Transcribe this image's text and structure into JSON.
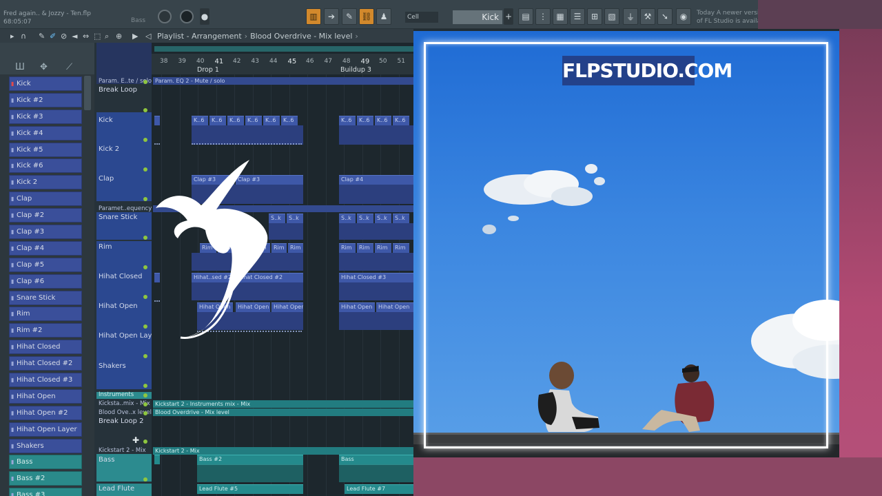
{
  "topbar": {
    "song_title": "Fred again.. & Jozzy - Ten.flp",
    "time": "68:05:07",
    "channel_label": "Bass",
    "snap_label": "Cell",
    "selected_channel": "Kick",
    "update_line1": "Today  A newer version",
    "update_line2": "of FL Studio is available!"
  },
  "playlist": {
    "breadcrumb": [
      "Playlist - Arrangement",
      "Blood Overdrive - Mix level"
    ],
    "ruler_numbers": [
      "38",
      "39",
      "40",
      "41",
      "42",
      "43",
      "44",
      "45",
      "46",
      "47",
      "48",
      "49",
      "50",
      "51"
    ],
    "markers": [
      "Drop 1",
      "Buildup 3"
    ]
  },
  "channel_rack": {
    "tracks": [
      "Kick",
      "Kick #2",
      "Kick #3",
      "Kick #4",
      "Kick #5",
      "Kick #6",
      "Kick 2",
      "Clap",
      "Clap #2",
      "Clap #3",
      "Clap #4",
      "Clap #5",
      "Clap #6",
      "Snare Stick",
      "Rim",
      "Rim #2",
      "Hihat Closed",
      "Hihat Closed #2",
      "Hihat Closed #3",
      "Hihat Open",
      "Hihat Open #2",
      "Hihat Open Layer",
      "Shakers",
      "Bass",
      "Bass #2",
      "Bass #3"
    ]
  },
  "playlist_tracks": {
    "top_auto": "Param. E..te / solo",
    "rows": [
      "Break Loop",
      "Kick",
      "Kick 2",
      "Clap",
      "Snare Stick",
      "Rim",
      "Hihat Closed",
      "Hihat Open",
      "Hihat Open Layer",
      "Shakers"
    ],
    "param_freq": "Paramet..equency",
    "instruments": "Instruments",
    "kickstart_mix": "Kicksta..mix - Mix",
    "blood_level": "Blood Ove..x level",
    "break_loop_2": "Break Loop 2",
    "kickstart2": "Kickstart 2 - Mix",
    "bass": "Bass",
    "lead_flute": "Lead Flute"
  },
  "clips": {
    "auto_eq": "Param. EQ 2 - Mute / solo",
    "kick_clip": "K..6",
    "clap3": "Clap #3",
    "clap4": "Clap #4",
    "snare_clip": "S..k",
    "rim": "Rim",
    "hihat_sed2": "Hihat..sed #2",
    "hihat_closed2": "Hihat Closed #2",
    "hihat_closed3": "Hihat Closed #3",
    "hihat_open": "Hihat Open",
    "kickstart_instr": "Kickstart 2 - Instruments mix - Mix",
    "blood_mix": "Blood Overdrive - Mix level",
    "kickstart2_mix": "Kickstart 2 - Mix",
    "bass2": "Bass #2",
    "bass": "Bass",
    "lead_flute5": "Lead Flute #5",
    "lead_flute7": "Lead Flute #7"
  },
  "cover": {
    "title": "FLPSTUDIO.COM"
  }
}
